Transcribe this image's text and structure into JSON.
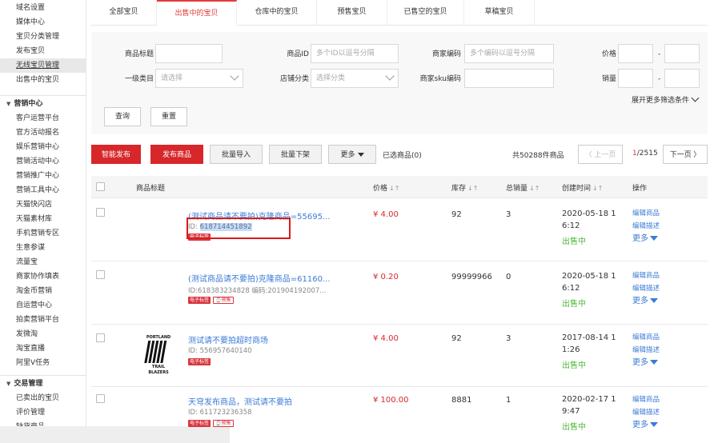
{
  "sidebar": {
    "group1": [
      "域名设置",
      "媒体中心",
      "宝贝分类管理",
      "发布宝贝",
      "无线宝贝管理",
      "出售中的宝贝"
    ],
    "active_item": "无线宝贝管理",
    "section_marketing": "营销中心",
    "marketing": [
      "客户运营平台",
      "官方活动报名",
      "娱乐营销中心",
      "营销活动中心",
      "营销推广中心",
      "营销工具中心",
      "天猫快闪店",
      "天猫素材库",
      "手机营销专区",
      "生意参谋",
      "流量宝",
      "商家协作填表",
      "淘金币营销",
      "自运营中心",
      "拍卖营销平台",
      "发微淘",
      "淘宝直播",
      "阿里V任务"
    ],
    "section_trade": "交易管理",
    "trade": [
      "已卖出的宝贝",
      "评价管理",
      "缺货商品"
    ]
  },
  "tabs": [
    "全部宝贝",
    "出售中的宝贝",
    "仓库中的宝贝",
    "预售宝贝",
    "已售空的宝贝",
    "草稿宝贝"
  ],
  "active_tab": 1,
  "filters": {
    "title_label": "商品标题",
    "id_label": "商品ID",
    "id_placeholder": "多个ID以逗号分隔",
    "code_label": "商家编码",
    "code_placeholder": "多个编码以逗号分隔",
    "price_label": "价格",
    "category_label": "一级类目",
    "category_placeholder": "请选择",
    "shop_cat_label": "店铺分类",
    "shop_cat_placeholder": "选择分类",
    "sku_label": "商家sku编码",
    "sales_label": "销量",
    "dash": "-",
    "expand_label": "展开更多筛选条件",
    "query_btn": "查询",
    "reset_btn": "重置"
  },
  "actions": {
    "smart_publish": "智能发布",
    "publish": "发布商品",
    "batch_import": "批量导入",
    "batch_delist": "批量下架",
    "more": "更多",
    "selected": "已选商品(0)",
    "total": "共50288件商品",
    "prev": "〈 上一页",
    "page_current": "1",
    "page_total": "/2515",
    "next": "下一页 〉"
  },
  "columns": {
    "title": "商品标题",
    "price": "价格",
    "stock": "库存",
    "sales": "总销量",
    "created": "创建时间",
    "ops": "操作",
    "sort_icon": "↓↑"
  },
  "rows": [
    {
      "title": "(测试商品请不要拍)克隆商品=55695...",
      "sub_prefix": "ID: ",
      "sub_id": "618714451892",
      "sub_rest": "",
      "tags": [
        "电子标签"
      ],
      "price": "¥ 4.00",
      "stock": "92",
      "sales": "3",
      "created": "2020-05-18 16:12",
      "status": "出售中",
      "op1": "编辑商品",
      "op2": "编辑描述",
      "op3": "更多"
    },
    {
      "title": "(测试商品请不要拍)克隆商品=61160...",
      "sub_prefix": "ID:618383234828 编码:201904192007...",
      "sub_id": "",
      "sub_rest": "",
      "tags": [
        "电子标签",
        "预售"
      ],
      "price": "¥ 0.20",
      "stock": "99999966",
      "sales": "0",
      "created": "2020-05-18 16:12",
      "status": "出售中",
      "op1": "编辑商品",
      "op2": "编辑描述",
      "op3": "更多"
    },
    {
      "title": "测试请不要拍超时商场",
      "sub_prefix": "ID: 556957640140",
      "sub_id": "",
      "sub_rest": "",
      "tags": [
        "电子标签"
      ],
      "price": "¥ 4.00",
      "stock": "92",
      "sales": "3",
      "created": "2017-08-14 11:26",
      "status": "出售中",
      "op1": "编辑商品",
      "op2": "编辑描述",
      "op3": "更多"
    },
    {
      "title": "天穹发布商品，测试请不要拍",
      "sub_prefix": "ID: 611723236358",
      "sub_id": "",
      "sub_rest": "",
      "tags": [
        "电子标签",
        "预售"
      ],
      "price": "¥ 100.00",
      "stock": "8881",
      "sales": "1",
      "created": "2020-02-17 19:47",
      "status": "出售中",
      "op1": "编辑商品",
      "op2": "编辑描述",
      "op3": "更多"
    }
  ],
  "thumb_text": {
    "top": "PORTLAND",
    "bottom1": "TRAIL",
    "bottom2": "BLAZERS"
  },
  "colors": {
    "accent_red": "#d7272b",
    "link_blue": "#3b7bd6",
    "status_green": "#4eb83a"
  }
}
